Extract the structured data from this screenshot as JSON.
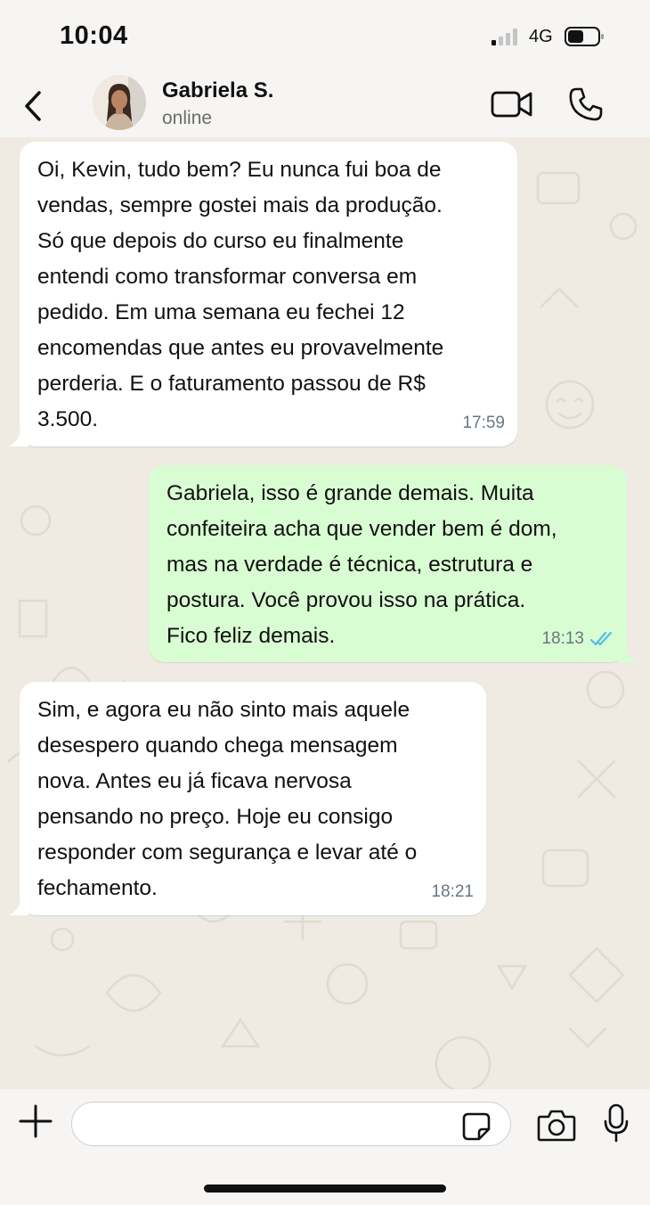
{
  "status_bar": {
    "time": "10:04",
    "network": "4G"
  },
  "chat_header": {
    "contact_name": "Gabriela S.",
    "contact_status": "online"
  },
  "colors": {
    "incoming_bubble": "#ffffff",
    "outgoing_bubble": "#d9fdd3",
    "read_ticks": "#53bdeb",
    "chat_background": "#efeae2"
  },
  "messages": [
    {
      "direction": "in",
      "text": "Oi, Kevin, tudo bem? Eu nunca fui boa de\nvendas, sempre gostei mais da produção.\nSó que depois do curso eu finalmente\nentendi como transformar conversa em\npedido. Em uma semana eu fechei 12\nencomendas que antes eu provavelmente\nperderia. E o faturamento passou de R$\n3.500.",
      "time": "17:59"
    },
    {
      "direction": "out",
      "text": "Gabriela, isso é grande demais. Muita\nconfeiteira acha que vender bem é dom,\nmas na verdade é técnica, estrutura e\npostura. Você provou isso na prática.\nFico feliz demais.",
      "time": "18:13",
      "status": "read"
    },
    {
      "direction": "in",
      "text": "Sim, e agora eu não sinto mais aquele\ndesespero quando chega mensagem\nnova. Antes eu já ficava nervosa\npensando no preço. Hoje eu consigo\nresponder com segurança e levar até o\nfechamento.",
      "time": "18:21"
    }
  ],
  "input_bar": {
    "message_value": "",
    "message_placeholder": ""
  },
  "icons": {
    "back": "chevron-left-icon",
    "video": "video-camera-icon",
    "call": "phone-icon",
    "attach": "plus-icon",
    "sticker": "sticker-icon",
    "camera": "camera-icon",
    "mic": "microphone-icon"
  }
}
